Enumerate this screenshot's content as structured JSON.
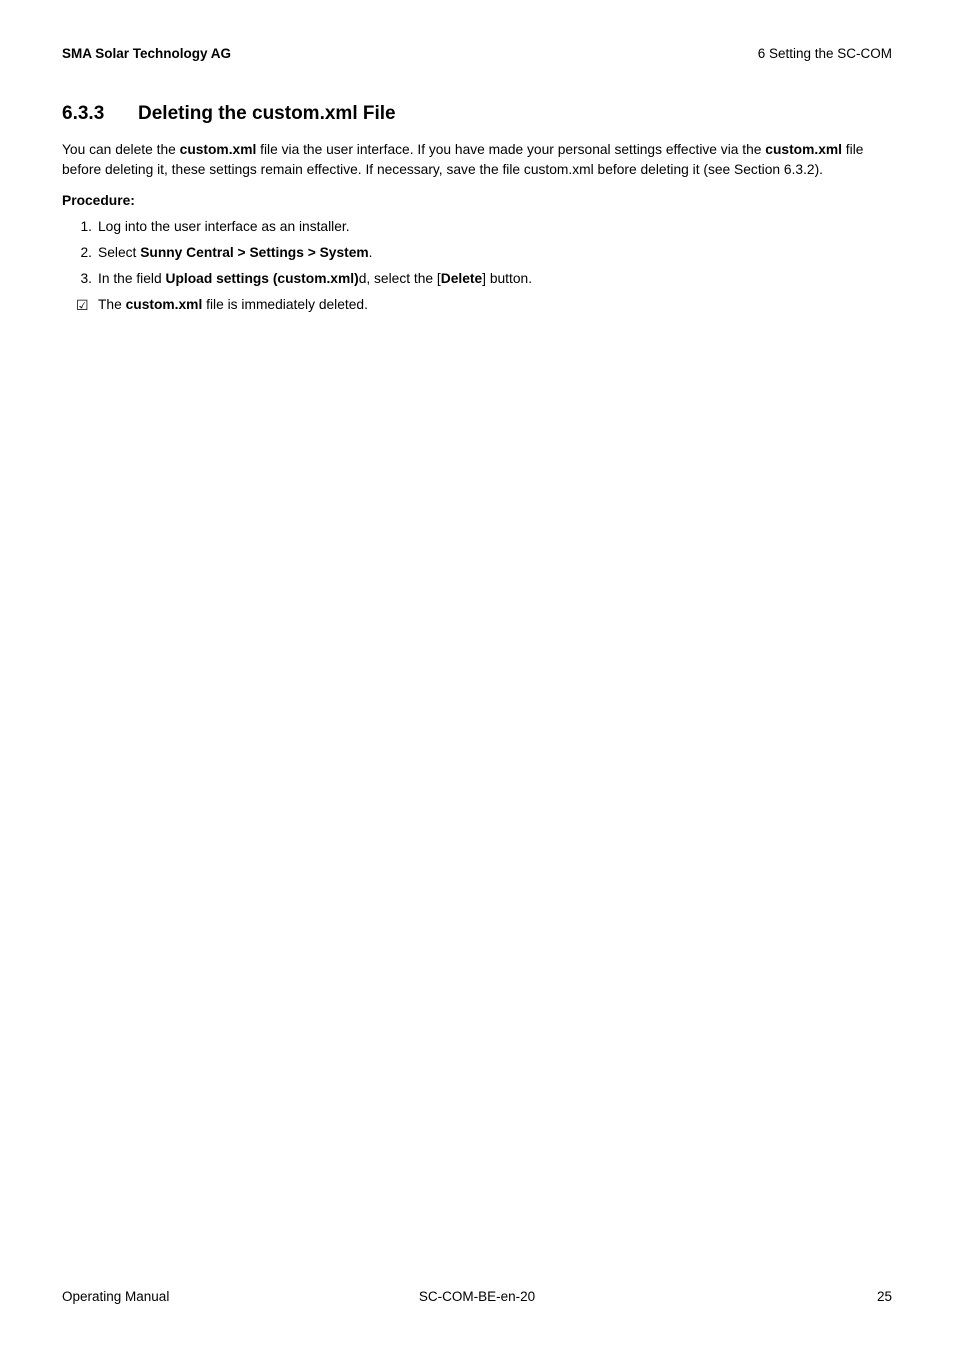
{
  "header": {
    "left": "SMA Solar Technology AG",
    "right": "6  Setting the SC-COM"
  },
  "section": {
    "number": "6.3.3",
    "title": "Deleting the custom.xml File"
  },
  "intro": {
    "t1": "You can delete the ",
    "b1": "custom.xml",
    "t2": " file via the user interface. If you have made your personal settings effective via the ",
    "b2": "custom.xml",
    "t3": " file before deleting it, these settings remain effective. If necessary, save the file custom.xml before deleting it (see Section 6.3.2)."
  },
  "procedure_label": "Procedure:",
  "steps": {
    "s1": {
      "marker": "1.",
      "text": "Log into the user interface as an installer."
    },
    "s2": {
      "marker": "2.",
      "t1": "Select ",
      "b1": "Sunny Central > Settings > System",
      "t2": "."
    },
    "s3": {
      "marker": "3.",
      "t1": "In the field ",
      "b1": "Upload settings (custom.xml)",
      "t2": "d, select the [",
      "b2": "Delete",
      "t3": "] button."
    },
    "result": {
      "marker": "☑",
      "t1": "The ",
      "b1": "custom.xml",
      "t2": " file is immediately deleted."
    }
  },
  "footer": {
    "left": "Operating Manual",
    "center": "SC-COM-BE-en-20",
    "right": "25"
  }
}
